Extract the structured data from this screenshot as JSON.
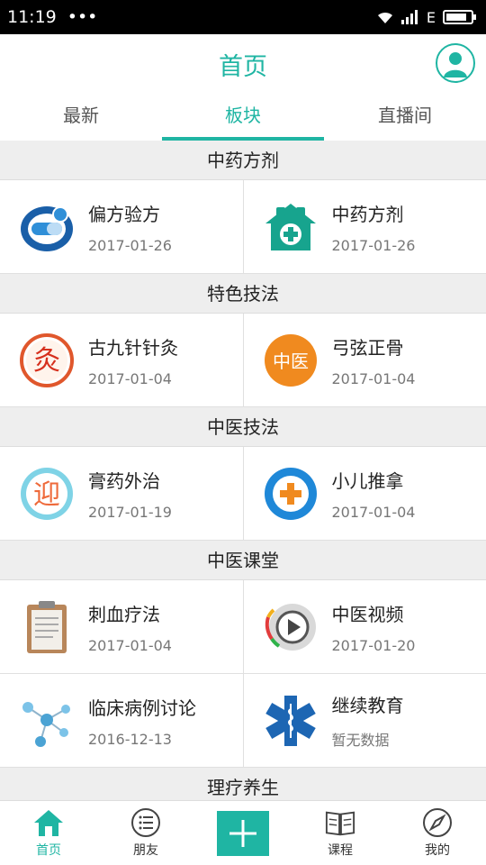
{
  "status_bar": {
    "time": "11:19",
    "dots": "•••",
    "network": "E"
  },
  "header": {
    "title": "首页"
  },
  "tabs": [
    {
      "label": "最新",
      "active": false
    },
    {
      "label": "板块",
      "active": true
    },
    {
      "label": "直播间",
      "active": false
    }
  ],
  "sections": [
    {
      "title": "中药方剂",
      "items": [
        {
          "title": "偏方验方",
          "date": "2017-01-26",
          "icon": "pill-icon"
        },
        {
          "title": "中药方剂",
          "date": "2017-01-26",
          "icon": "pharmacy-icon"
        }
      ]
    },
    {
      "title": "特色技法",
      "items": [
        {
          "title": "古九针针灸",
          "date": "2017-01-04",
          "icon": "moxibustion-icon",
          "glyph": "灸"
        },
        {
          "title": "弓弦正骨",
          "date": "2017-01-04",
          "icon": "chinese-medicine-icon",
          "glyph": "中医"
        }
      ]
    },
    {
      "title": "中医技法",
      "items": [
        {
          "title": "膏药外治",
          "date": "2017-01-19",
          "icon": "plaster-icon",
          "glyph": "迎"
        },
        {
          "title": "小儿推拿",
          "date": "2017-01-04",
          "icon": "medical-cross-icon"
        }
      ]
    },
    {
      "title": "中医课堂",
      "items": [
        {
          "title": "刺血疗法",
          "date": "2017-01-04",
          "icon": "clipboard-icon"
        },
        {
          "title": "中医视频",
          "date": "2017-01-20",
          "icon": "video-play-icon"
        },
        {
          "title": "临床病例讨论",
          "date": "2016-12-13",
          "icon": "molecule-icon"
        },
        {
          "title": "继续教育",
          "date": "暂无数据",
          "icon": "star-of-life-icon"
        }
      ]
    },
    {
      "title": "理疗养生",
      "items": []
    }
  ],
  "bottom_nav": [
    {
      "label": "首页",
      "icon": "home-icon",
      "active": true
    },
    {
      "label": "朋友",
      "icon": "list-icon",
      "active": false
    },
    {
      "label": "",
      "icon": "plus-icon",
      "active": false
    },
    {
      "label": "课程",
      "icon": "book-icon",
      "active": false
    },
    {
      "label": "我的",
      "icon": "compass-icon",
      "active": false
    }
  ],
  "colors": {
    "accent": "#1fb5a3"
  }
}
